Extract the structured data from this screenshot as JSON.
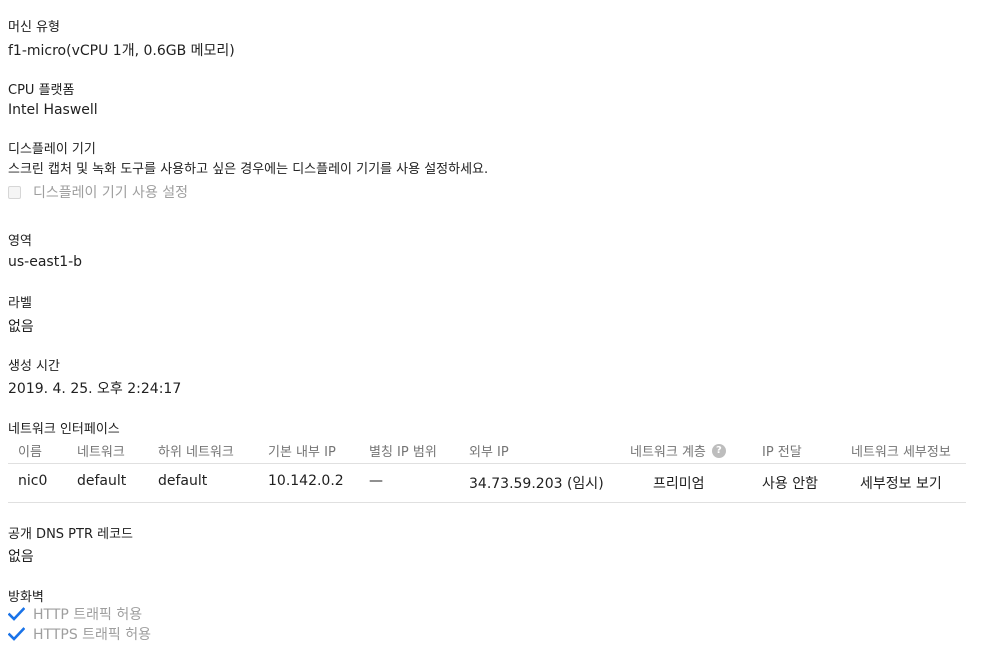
{
  "machine_type": {
    "label": "머신 유형",
    "value": "f1-micro(vCPU 1개, 0.6GB 메모리)"
  },
  "cpu_platform": {
    "label": "CPU 플랫폼",
    "value": "Intel Haswell"
  },
  "display_device": {
    "label": "디스플레이 기기",
    "description": "스크린 캡처 및 녹화 도구를 사용하고 싶은 경우에는 디스플레이 기기를 사용 설정하세요.",
    "checkbox_label": "디스플레이 기기 사용 설정"
  },
  "zone": {
    "label": "영역",
    "value": "us-east1-b"
  },
  "labels": {
    "label": "라벨",
    "value": "없음"
  },
  "creation_time": {
    "label": "생성 시간",
    "value": "2019. 4. 25. 오후 2:24:17"
  },
  "network_interfaces": {
    "label": "네트워크 인터페이스",
    "headers": {
      "name": "이름",
      "network": "네트워크",
      "subnetwork": "하위 네트워크",
      "internal_ip": "기본 내부 IP",
      "alias_ip": "별칭 IP 범위",
      "external_ip": "외부 IP",
      "tier": "네트워크 계층",
      "ip_forwarding": "IP 전달",
      "details": "네트워크 세부정보"
    },
    "rows": [
      {
        "name": "nic0",
        "network": "default",
        "subnetwork": "default",
        "internal_ip": "10.142.0.2",
        "alias_ip": "—",
        "external_ip": "34.73.59.203 (임시)",
        "tier": "프리미엄",
        "ip_forwarding": "사용 안함",
        "details": "세부정보 보기"
      }
    ]
  },
  "public_dns": {
    "label": "공개 DNS PTR 레코드",
    "value": "없음"
  },
  "firewall": {
    "label": "방화벽",
    "http": "HTTP 트래픽 허용",
    "https": "HTTPS 트래픽 허용"
  },
  "colors": {
    "check": "#1a73e8",
    "muted_text": "#9e9e9e",
    "divider": "#e0e0e0"
  },
  "icons": {
    "help": "help-circle-icon",
    "check": "checkmark-icon"
  }
}
